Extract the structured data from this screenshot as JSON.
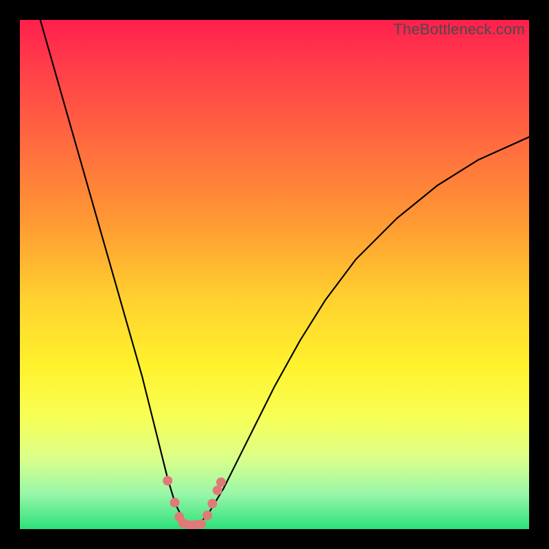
{
  "watermark": "TheBottleneck.com",
  "chart_data": {
    "type": "line",
    "title": "",
    "xlabel": "",
    "ylabel": "",
    "xlim": [
      0,
      100
    ],
    "ylim": [
      0,
      100
    ],
    "series": [
      {
        "name": "bottleneck-curve",
        "x": [
          4,
          8,
          12,
          16,
          20,
          24,
          27,
          29,
          30.5,
          32,
          33,
          34,
          35,
          37,
          40,
          45,
          50,
          55,
          60,
          66,
          74,
          82,
          90,
          100
        ],
        "values": [
          100,
          86,
          72,
          58,
          44,
          30,
          18,
          10,
          5,
          2,
          0.8,
          0.5,
          0.8,
          3,
          8,
          18,
          28,
          37,
          45,
          53,
          61,
          67.5,
          72.5,
          77
        ]
      }
    ],
    "markers": {
      "name": "highlight-dots",
      "color": "#e07a78",
      "points": [
        {
          "x": 29.0,
          "y": 9.5
        },
        {
          "x": 30.4,
          "y": 5.2
        },
        {
          "x": 31.3,
          "y": 2.4
        },
        {
          "x": 32.0,
          "y": 1.2
        },
        {
          "x": 33.2,
          "y": 0.8
        },
        {
          "x": 34.4,
          "y": 0.8
        },
        {
          "x": 35.6,
          "y": 1.0
        },
        {
          "x": 36.8,
          "y": 2.7
        },
        {
          "x": 37.8,
          "y": 5.0
        },
        {
          "x": 38.8,
          "y": 7.6
        },
        {
          "x": 39.5,
          "y": 9.2
        }
      ]
    },
    "legend": false,
    "grid": false
  }
}
